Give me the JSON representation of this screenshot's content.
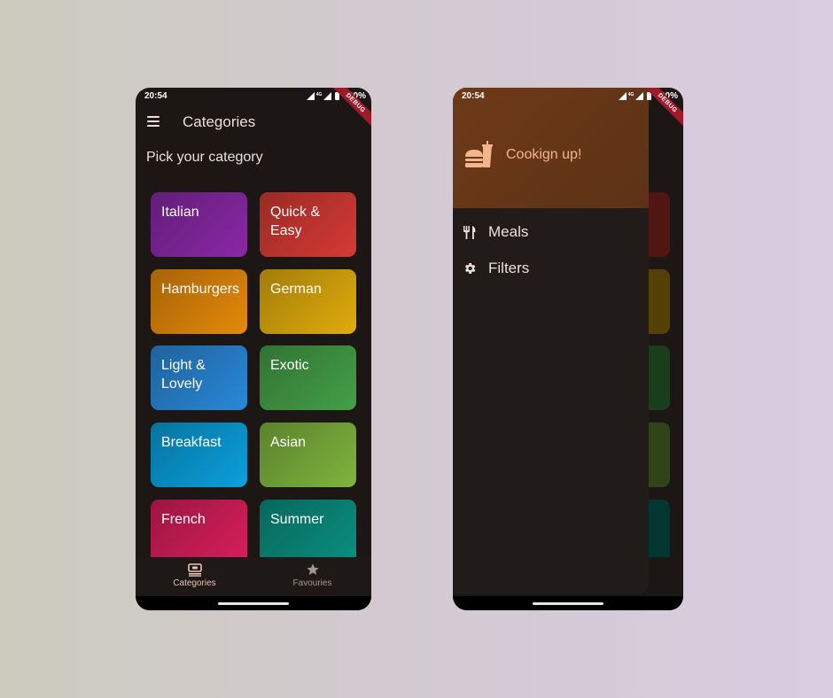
{
  "screens": {
    "left": {
      "status": {
        "time": "20:54",
        "network": "4G",
        "battery": "100%"
      },
      "debug_banner": "DEBUG",
      "app_bar": {
        "title": "Categories",
        "menu_icon": "menu-icon"
      },
      "subtitle": "Pick your category",
      "categories": [
        {
          "label": "Italian",
          "color": "#8a28a6"
        },
        {
          "label": "Quick & Easy",
          "color": "#d63a34"
        },
        {
          "label": "Hamburgers",
          "color": "#e58a0a"
        },
        {
          "label": "German",
          "color": "#e0ac0c"
        },
        {
          "label": "Light & Lovely",
          "color": "#2a88d8"
        },
        {
          "label": "Exotic",
          "color": "#44a047"
        },
        {
          "label": "Breakfast",
          "color": "#0aa0dc"
        },
        {
          "label": "Asian",
          "color": "#7fb43e"
        },
        {
          "label": "French",
          "color": "#d81e5c"
        },
        {
          "label": "Summer",
          "color": "#0a8f80"
        }
      ],
      "bottom_nav": [
        {
          "label": "Categories",
          "icon": "set-meal-icon",
          "selected": true,
          "color": "#e8c4b4"
        },
        {
          "label": "Favouries",
          "icon": "star-icon",
          "selected": false,
          "color": "#a09894"
        }
      ]
    },
    "right": {
      "status": {
        "time": "20:54",
        "network": "4G",
        "battery": "100%"
      },
      "debug_banner": "DEBUG",
      "drawer": {
        "header_title": "Cookign up!",
        "header_icon": "fastfood-icon",
        "accent": "#f4b48c",
        "items": [
          {
            "label": "Meals",
            "icon": "restaurant-icon"
          },
          {
            "label": "Filters",
            "icon": "settings-icon"
          }
        ]
      }
    }
  }
}
